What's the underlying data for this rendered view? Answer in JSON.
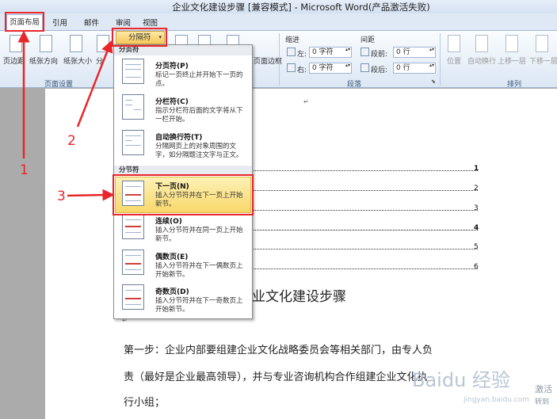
{
  "window": {
    "title": "企业文化建设步骤 [兼容模式] - Microsoft Word(产品激活失败)"
  },
  "tabs": [
    {
      "label": "页面布局"
    },
    {
      "label": "引用"
    },
    {
      "label": "邮件"
    },
    {
      "label": "审阅"
    },
    {
      "label": "视图"
    }
  ],
  "ribbon": {
    "page_setup": {
      "margins": "页边距",
      "orientation": "纸张方向",
      "size": "纸张大小",
      "columns": "分",
      "group_label": "页面设置"
    },
    "breaks_button": "分隔符",
    "page_border": "页面边框",
    "indent": {
      "title": "缩进",
      "left_label": "左:",
      "left_value": "0 字符",
      "right_label": "右:",
      "right_value": "0 字符"
    },
    "spacing": {
      "title": "间距",
      "before_label": "段前:",
      "before_value": "0 行",
      "after_label": "段后:",
      "after_value": "0 行"
    },
    "paragraph_group": "段落",
    "arrange": {
      "position": "位置",
      "wrap": "自动换行",
      "bring_forward": "上移一层",
      "send_backward": "下移一层",
      "group_label": "排列"
    }
  },
  "breaks_menu": {
    "page_breaks_header": "分页符",
    "section_breaks_header": "分节符",
    "items": [
      {
        "title": "分页符(P)",
        "desc": "标记一页终止并开始下一页的点。"
      },
      {
        "title": "分栏符(C)",
        "desc": "指示分栏符后面的文字将从下一栏开始。"
      },
      {
        "title": "自动换行符(T)",
        "desc": "分隔网页上的对象周围的文字，如分隔题注文字与正文。"
      },
      {
        "title": "下一页(N)",
        "desc": "插入分节符并在下一页上开始新节。"
      },
      {
        "title": "连续(O)",
        "desc": "插入分节符并在同一页上开始新节。"
      },
      {
        "title": "偶数页(E)",
        "desc": "插入分节符并在下一偶数页上开始新节。"
      },
      {
        "title": "奇数页(D)",
        "desc": "插入分节符并在下一奇数页上开始新节。"
      }
    ]
  },
  "document": {
    "toc_numbers": [
      "1",
      "2",
      "3",
      "4",
      "5",
      "6"
    ],
    "heading": "业文化建设步骤",
    "para1": "第一步：企业内部要组建企业文化战略委员会等相关部门，由专人负",
    "para2": "责（最好是企业最高领导），并与专业咨询机构合作组建企业文化执",
    "para3": "行小组；"
  },
  "annotations": {
    "step1": "1",
    "step2": "2",
    "step3": "3"
  },
  "watermark": {
    "brand": "Baidu 经验",
    "url": "jingyan.baidu.com"
  },
  "activation": {
    "line1": "激活",
    "line2": "转到"
  },
  "colors": {
    "annotation_red": "#e8262b",
    "highlight": "#f9d86a"
  }
}
